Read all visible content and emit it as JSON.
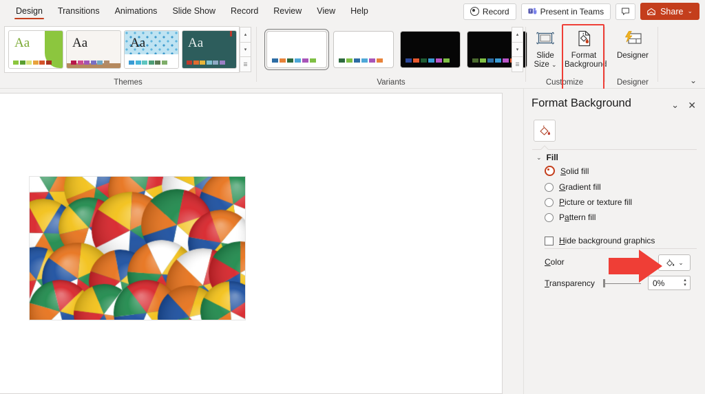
{
  "app": {
    "accent_color": "#c43e1c",
    "annotation_color": "#ef3e36",
    "ribbon_bg": "#f3f2f1"
  },
  "tabbar": {
    "tabs": [
      {
        "label": "Design",
        "active": true
      },
      {
        "label": "Transitions",
        "active": false
      },
      {
        "label": "Animations",
        "active": false
      },
      {
        "label": "Slide Show",
        "active": false
      },
      {
        "label": "Record",
        "active": false
      },
      {
        "label": "Review",
        "active": false
      },
      {
        "label": "View",
        "active": false
      },
      {
        "label": "Help",
        "active": false
      }
    ],
    "record_button": {
      "label": "Record",
      "icon": "record-dot-icon"
    },
    "present_in_teams_button": {
      "label": "Present in Teams",
      "icon": "teams-icon"
    },
    "comments_button": {
      "icon": "comment-bubble-icon"
    },
    "share_button": {
      "label": "Share",
      "icon": "share-icon",
      "chevron": "⌄"
    }
  },
  "ribbon": {
    "groups": [
      {
        "name": "themes",
        "label": "Themes"
      },
      {
        "name": "variants",
        "label": "Variants"
      },
      {
        "name": "customize",
        "label": "Customize"
      },
      {
        "name": "designer",
        "label": "Designer"
      }
    ],
    "themes": {
      "label": "Themes",
      "items": [
        {
          "name": "theme-facet",
          "aa": "Aa",
          "aa_color": "#7aa932",
          "bg": "#ffffff",
          "accent_shape_color": "#8cc63e",
          "swatches": [
            "#8cc63e",
            "#5a9e2f",
            "#d9e27a",
            "#e8a33d",
            "#d4542b",
            "#a8321f"
          ]
        },
        {
          "name": "theme-ion-boardroom",
          "aa": "Aa",
          "aa_color": "#1b1b1b",
          "bg": "#f7f4f1",
          "accent_shape_color": "#b5895e",
          "swatches": [
            "#b8174a",
            "#cf4b8e",
            "#a255b5",
            "#7a6fc4",
            "#6fa8c4",
            "#b08b6a"
          ]
        },
        {
          "name": "theme-wisp-pattern",
          "aa": "Aa",
          "aa_color": "#1b1b1b",
          "bg": "#ffffff",
          "accent_shape_color": "#4fa8d8",
          "swatches": [
            "#3a9bd4",
            "#47b5d8",
            "#5fc6c0",
            "#4f9e77",
            "#5d7a52",
            "#7fae6a"
          ]
        },
        {
          "name": "theme-dark-teal",
          "aa": "Aa",
          "aa_color": "#e8efee",
          "bg": "#2d5d5c",
          "accent_shape_color": "#c0392b",
          "swatches": [
            "#c0392b",
            "#e06b2e",
            "#e8b53a",
            "#7fbfcf",
            "#8fa9c4",
            "#9b7fc4"
          ]
        }
      ],
      "scroll_up": "▴",
      "scroll_down": "▾",
      "scroll_more": "☰"
    },
    "variants": {
      "label": "Variants",
      "items": [
        {
          "name": "variant-1",
          "bg": "#ffffff",
          "selected": true,
          "swatches": [
            "#2e6da4",
            "#e8833a",
            "#2d6a3f",
            "#4fa8d8",
            "#a855b8",
            "#7fbf45"
          ]
        },
        {
          "name": "variant-2",
          "bg": "#ffffff",
          "selected": false,
          "swatches": [
            "#2d6a3f",
            "#7fbf45",
            "#2e6da4",
            "#4fa8d8",
            "#a855b8",
            "#e8833a"
          ]
        },
        {
          "name": "variant-3",
          "bg": "#060606",
          "selected": false,
          "swatches": [
            "#2e4a9e",
            "#e8592e",
            "#1f5c33",
            "#3a9bd4",
            "#b855c8",
            "#7fbf45"
          ]
        },
        {
          "name": "variant-4",
          "bg": "#060606",
          "selected": false,
          "swatches": [
            "#4a6a2e",
            "#7fbf45",
            "#2e6da4",
            "#3a9bd4",
            "#b855c8",
            "#e8592e"
          ]
        }
      ],
      "scroll_up": "▴",
      "scroll_down": "▾",
      "scroll_more": "☰"
    },
    "customize": {
      "label": "Customize",
      "slide_size_button": {
        "label_line1": "Slide",
        "label_line2": "Size",
        "chevron": "⌄",
        "icon": "slide-size-icon"
      },
      "format_background_button": {
        "label_line1": "Format",
        "label_line2": "Background",
        "icon": "format-background-icon",
        "highlighted": true
      }
    },
    "designer": {
      "label": "Designer",
      "designer_button": {
        "label": "Designer",
        "icon": "designer-icon"
      }
    },
    "collapse_chevron": "⌄"
  },
  "slide": {
    "image": {
      "name": "beach-balls-photo",
      "alt": "Pile of colorful beach balls"
    }
  },
  "pane": {
    "title": "Format Background",
    "dropdown_icon": "chevron-down-icon",
    "close_icon": "close-icon",
    "fill_tab_icon": "paint-bucket-icon",
    "section": {
      "label": "Fill",
      "collapse_icon": "chevron-down-icon"
    },
    "fill_options": [
      {
        "name": "solid-fill",
        "label": "Solid fill",
        "mnemonic": "S",
        "selected": true
      },
      {
        "name": "gradient-fill",
        "label": "Gradient fill",
        "mnemonic": "G",
        "selected": false
      },
      {
        "name": "picture-or-texture-fill",
        "label": "Picture or texture fill",
        "mnemonic": "P",
        "selected": false
      },
      {
        "name": "pattern-fill",
        "label": "Pattern fill",
        "mnemonic": "a",
        "selected": false
      }
    ],
    "hide_background_graphics": {
      "label": "Hide background graphics",
      "mnemonic": "H",
      "checked": false
    },
    "color_row": {
      "label": "Color",
      "mnemonic": "C",
      "button_icon": "paint-bucket-icon",
      "button_chevron": "⌄"
    },
    "transparency_row": {
      "label": "Transparency",
      "mnemonic": "T",
      "value": "0%",
      "slider_percent": 0,
      "spinner_up": "▴",
      "spinner_down": "▾"
    }
  },
  "annotation": {
    "arrow": {
      "name": "red-pointer-arrow",
      "color": "#ef3e36",
      "points_to": "color-picker-button"
    }
  }
}
